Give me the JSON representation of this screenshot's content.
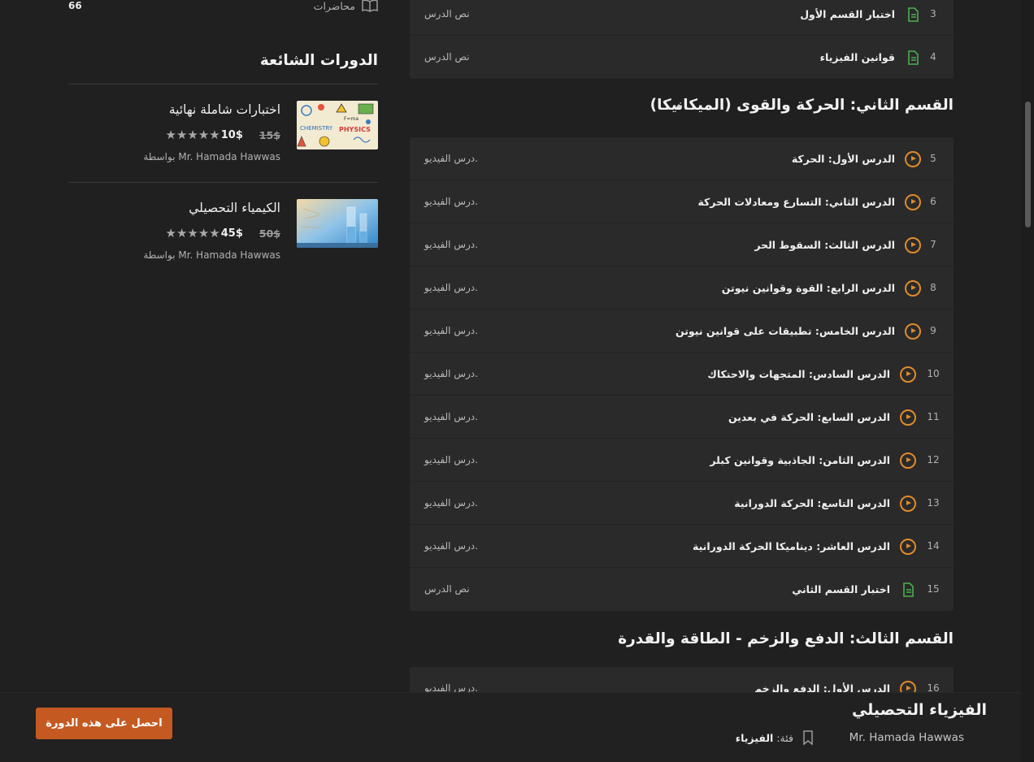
{
  "sidebar": {
    "lectures_count": "66",
    "lectures_label": "محاضرات",
    "popular_title": "الدورات الشائعة",
    "courses": [
      {
        "title": "اختبارات شاملة نهائية",
        "old_price": "15$",
        "new_price": "10$",
        "by": "بواسطة Mr. Hamada Hawwas",
        "thumb_icon": "chemistry-physics-thumbnail",
        "rating": 5
      },
      {
        "title": "الكيمياء التحصيلي",
        "old_price": "50$",
        "new_price": "45$",
        "by": "بواسطة Mr. Hamada Hawwas",
        "thumb_icon": "lab-glassware-thumbnail",
        "rating": 5
      }
    ]
  },
  "curriculum": {
    "section1_rows": [
      {
        "num": "3",
        "title": "اختبار القسم الأول",
        "type": "نص الدرس",
        "icon": "document-icon"
      },
      {
        "num": "4",
        "title": "قوانين الفيزياء",
        "type": "نص الدرس",
        "icon": "document-icon"
      }
    ],
    "section2": {
      "title": "القسم الثاني: الحركة والقوى (الميكانيكا)",
      "rows": [
        {
          "num": "5",
          "title": "الدرس الأول: الحركة",
          "type": "درس الفيديو.",
          "icon": "play-icon"
        },
        {
          "num": "6",
          "title": "الدرس الثاني: التسارع ومعادلات الحركة",
          "type": "درس الفيديو.",
          "icon": "play-icon"
        },
        {
          "num": "7",
          "title": "الدرس الثالث: السقوط الحر",
          "type": "درس الفيديو.",
          "icon": "play-icon"
        },
        {
          "num": "8",
          "title": "الدرس الرابع: القوة وقوانين نيوتن",
          "type": "درس الفيديو.",
          "icon": "play-icon"
        },
        {
          "num": "9",
          "title": "الدرس الخامس: تطبيقات على قوانين نيوتن",
          "type": "درس الفيديو.",
          "icon": "play-icon"
        },
        {
          "num": "10",
          "title": "الدرس السادس: المتجهات والاحتكاك",
          "type": "درس الفيديو.",
          "icon": "play-icon"
        },
        {
          "num": "11",
          "title": "الدرس السابع: الحركة في بعدين",
          "type": "درس الفيديو.",
          "icon": "play-icon"
        },
        {
          "num": "12",
          "title": "الدرس الثامن: الجاذبية وقوانين كبلر",
          "type": "درس الفيديو.",
          "icon": "play-icon"
        },
        {
          "num": "13",
          "title": "الدرس التاسع: الحركة الدورانية",
          "type": "درس الفيديو.",
          "icon": "play-icon"
        },
        {
          "num": "14",
          "title": "الدرس العاشر: ديناميكا الحركة الدورانية",
          "type": "درس الفيديو.",
          "icon": "play-icon"
        },
        {
          "num": "15",
          "title": "اختبار القسم الثاني",
          "type": "نص الدرس",
          "icon": "document-icon"
        }
      ]
    },
    "section3": {
      "title": "القسم الثالث: الدفع والزخم - الطاقة والقدرة",
      "rows": [
        {
          "num": "16",
          "title": "الدرس الأول: الدفع والزخم",
          "type": "درس الفيديو.",
          "icon": "play-icon"
        }
      ]
    }
  },
  "bottom_bar": {
    "cta_label": "احصل على هذه الدورة",
    "course_title": "الفيزياء التحصيلي",
    "author": "Mr. Hamada Hawwas",
    "category_label": "فئة:",
    "category_value": "الفيزياء"
  },
  "colors": {
    "accent": "#c45a22",
    "play": "#e08a2a",
    "doc": "#4caf50"
  }
}
